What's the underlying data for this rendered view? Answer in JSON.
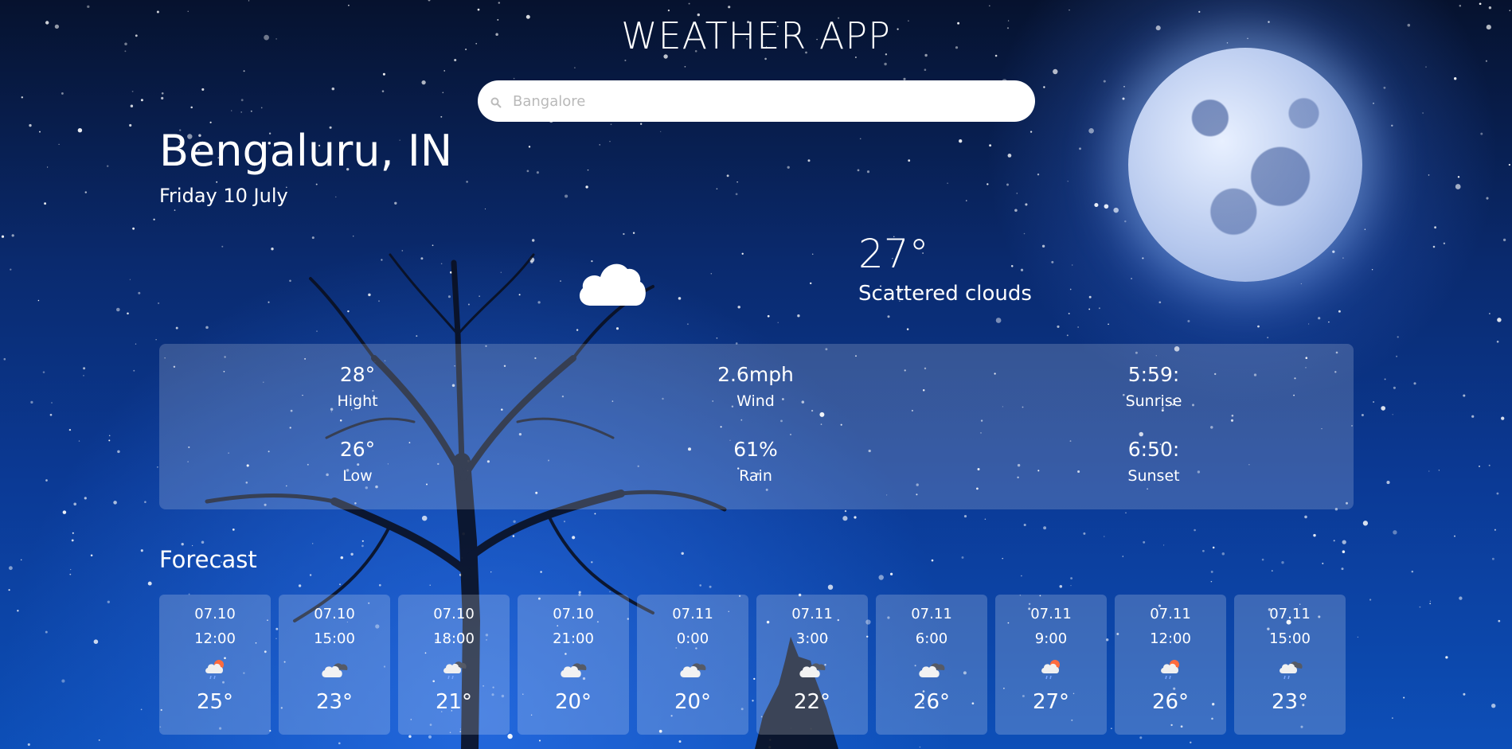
{
  "app": {
    "title": "WEATHER APP"
  },
  "search": {
    "placeholder": "Bangalore",
    "icon": "search-icon"
  },
  "location": {
    "city": "Bengaluru, IN",
    "date": "Friday 10 July"
  },
  "current": {
    "temperature": "27°",
    "description": "Scattered clouds",
    "icon": "cloud-icon"
  },
  "stats": {
    "high": {
      "value": "28°",
      "label": "Hight"
    },
    "low": {
      "value": "26°",
      "label": "Low"
    },
    "wind": {
      "value": "2.6mph",
      "label": "Wind"
    },
    "rain": {
      "value": "61%",
      "label": "Rain"
    },
    "sunrise": {
      "value": "5:59:",
      "label": "Sunrise"
    },
    "sunset": {
      "value": "6:50:",
      "label": "Sunset"
    }
  },
  "forecast": {
    "title": "Forecast",
    "items": [
      {
        "date": "07.10",
        "time": "12:00",
        "temp": "25°",
        "icon": "sun-cloud-rain-icon"
      },
      {
        "date": "07.10",
        "time": "15:00",
        "temp": "23°",
        "icon": "clouds-icon"
      },
      {
        "date": "07.10",
        "time": "18:00",
        "temp": "21°",
        "icon": "cloud-rain-icon"
      },
      {
        "date": "07.10",
        "time": "21:00",
        "temp": "20°",
        "icon": "clouds-icon"
      },
      {
        "date": "07.11",
        "time": "0:00",
        "temp": "20°",
        "icon": "clouds-icon"
      },
      {
        "date": "07.11",
        "time": "3:00",
        "temp": "22°",
        "icon": "clouds-icon"
      },
      {
        "date": "07.11",
        "time": "6:00",
        "temp": "26°",
        "icon": "clouds-icon"
      },
      {
        "date": "07.11",
        "time": "9:00",
        "temp": "27°",
        "icon": "sun-cloud-rain-icon"
      },
      {
        "date": "07.11",
        "time": "12:00",
        "temp": "26°",
        "icon": "sun-cloud-rain-icon"
      },
      {
        "date": "07.11",
        "time": "15:00",
        "temp": "23°",
        "icon": "cloud-rain-icon"
      }
    ]
  }
}
